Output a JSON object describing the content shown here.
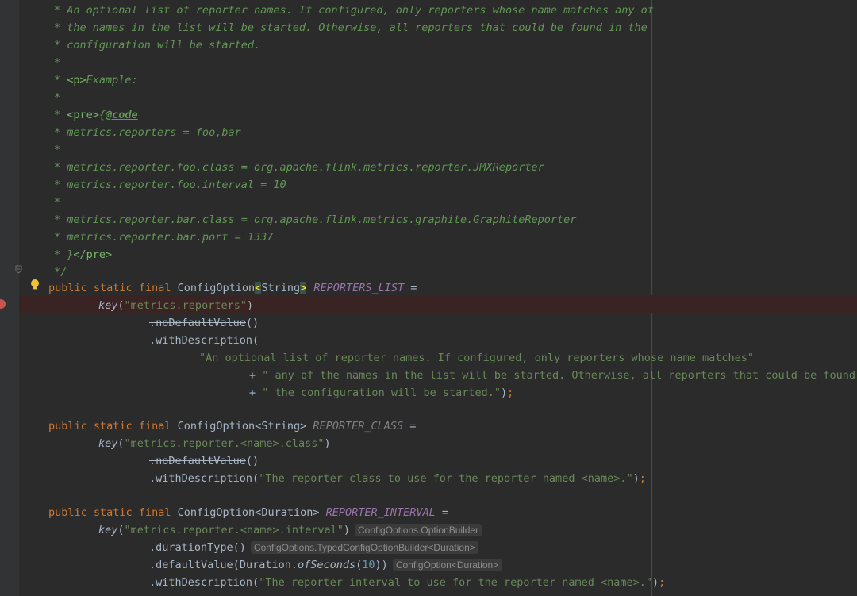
{
  "editor": {
    "doc_lines": [
      "* An optional list of reporter names. If configured, only reporters whose name matches any of",
      "* the names in the list will be started. Otherwise, all reporters that could be found in the",
      "* configuration will be started.",
      "*",
      "* ",
      "<p>",
      "Example:",
      "*",
      "* ",
      "<pre>",
      "{",
      "@code",
      "* metrics.reporters = foo,bar",
      "*",
      "* metrics.reporter.foo.class = org.apache.flink.metrics.reporter.JMXReporter",
      "* metrics.reporter.foo.interval = 10",
      "*",
      "* metrics.reporter.bar.class = org.apache.flink.metrics.graphite.GraphiteReporter",
      "* metrics.reporter.bar.port = 1337",
      "* }",
      "</pre>",
      "*/"
    ],
    "kw": {
      "public": "public",
      "static": "static",
      "final": "final"
    },
    "types": {
      "config_option": "ConfigOption",
      "string": "String",
      "duration": "Duration"
    },
    "symbols": {
      "lt": "<",
      "gt": ">",
      "eq": " =",
      "lparen": "(",
      "rparen": ")",
      "semi": ";",
      "empty_call": "()",
      "dot_open": ".withDescription(",
      "space": " "
    },
    "fields": {
      "reporters_list": "REPORTERS_LIST",
      "reporter_class": "REPORTER_CLASS",
      "reporter_interval": "REPORTER_INTERVAL"
    },
    "calls": {
      "key": "key",
      "no_default": ".noDefaultValue",
      "with_description": ".withDescription",
      "duration_type": ".durationType",
      "default_value": ".defaultValue",
      "duration_cls": "Duration.",
      "of_seconds": "ofSeconds"
    },
    "strings": {
      "key_reporters": "\"metrics.reporters\"",
      "desc1": "\"An optional list of reporter names. If configured, only reporters whose name matches\"",
      "desc2_plus": "+ ",
      "desc2": "\" any of the names in the list will be started. Otherwise, all reporters that could be found in",
      "desc3": "\" the configuration will be started.\"",
      "key_class": "\"metrics.reporter.<name>.class\"",
      "desc_class": "\"The reporter class to use for the reporter named <name>.\"",
      "key_interval": "\"metrics.reporter.<name>.interval\"",
      "desc_interval": "\"The reporter interval to use for the reporter named <name>.\""
    },
    "numbers": {
      "ten": "10"
    },
    "hints": {
      "option_builder": "ConfigOptions.OptionBuilder",
      "typed_builder": "ConfigOptions.TypedConfigOptionBuilder<Duration>",
      "config_option_duration": "ConfigOption<Duration>"
    }
  }
}
